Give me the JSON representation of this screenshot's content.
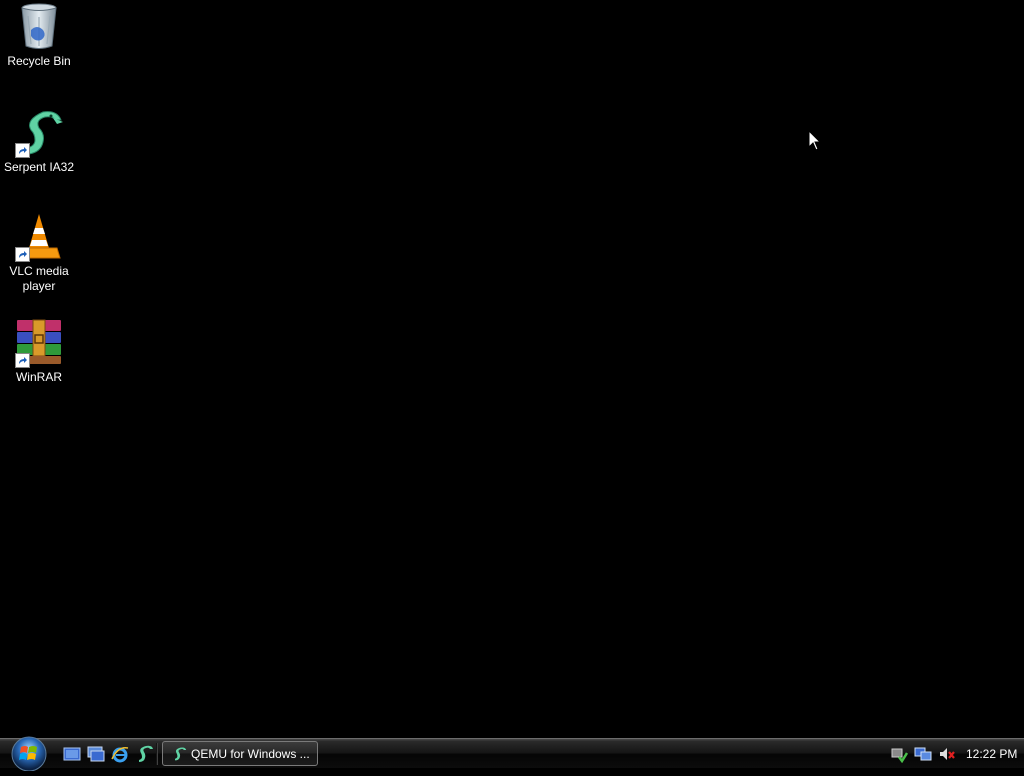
{
  "desktop": {
    "icons": [
      {
        "label": "Recycle Bin",
        "icon": "recycle-bin-icon"
      },
      {
        "label": "Serpent IA32",
        "icon": "serpent-icon"
      },
      {
        "label": "VLC media player",
        "icon": "vlc-cone-icon"
      },
      {
        "label": "WinRAR",
        "icon": "winrar-icon"
      }
    ]
  },
  "taskbar": {
    "start_icon": "windows-orb-icon",
    "quick_launch": [
      {
        "icon": "show-desktop-icon"
      },
      {
        "icon": "switch-windows-icon"
      },
      {
        "icon": "internet-explorer-icon"
      },
      {
        "icon": "serpent-icon"
      }
    ],
    "tasks": [
      {
        "label": "QEMU for Windows ...",
        "icon": "serpent-icon"
      }
    ],
    "tray": {
      "icons": [
        "safely-remove-hardware-icon",
        "network-icon",
        "volume-muted-icon"
      ],
      "clock": "12:22 PM"
    }
  },
  "colors": {
    "desktop_bg": "#000000",
    "taskbar_bg": "#141414",
    "text": "#ffffff"
  }
}
